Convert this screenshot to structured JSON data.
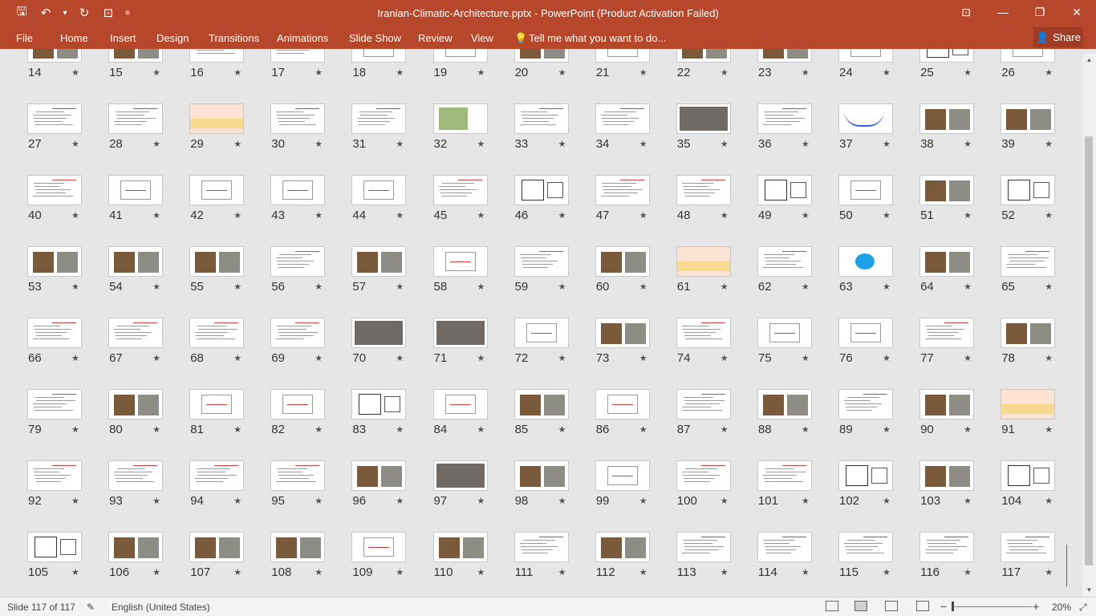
{
  "window": {
    "title": "Iranian-Climatic-Architecture.pptx - PowerPoint (Product Activation Failed)",
    "controls": {
      "ribbon_display": "⊡",
      "minimize": "—",
      "restore": "❐",
      "close": "✕"
    }
  },
  "qat": {
    "save": "🖫",
    "undo": "↶",
    "undo_dropdown": "▾",
    "redo": "↻",
    "present": "⊡",
    "customize": "≡"
  },
  "menu": {
    "items": [
      "File",
      "Home",
      "Insert",
      "Design",
      "Transitions",
      "Animations",
      "Slide Show",
      "Review",
      "View"
    ],
    "tell_me": "Tell me what you want to do...",
    "share": "Share"
  },
  "slides": {
    "star": "★",
    "numbers": [
      "14",
      "15",
      "16",
      "17",
      "18",
      "19",
      "20",
      "21",
      "22",
      "23",
      "24",
      "25",
      "26",
      "27",
      "28",
      "29",
      "30",
      "31",
      "32",
      "33",
      "34",
      "35",
      "36",
      "37",
      "38",
      "39",
      "40",
      "41",
      "42",
      "43",
      "44",
      "45",
      "46",
      "47",
      "48",
      "49",
      "50",
      "51",
      "52",
      "53",
      "54",
      "55",
      "56",
      "57",
      "58",
      "59",
      "60",
      "61",
      "62",
      "63",
      "64",
      "65",
      "66",
      "67",
      "68",
      "69",
      "70",
      "71",
      "72",
      "73",
      "74",
      "75",
      "76",
      "77",
      "78",
      "79",
      "80",
      "81",
      "82",
      "83",
      "84",
      "85",
      "86",
      "87",
      "88",
      "89",
      "90",
      "91",
      "92",
      "93",
      "94",
      "95",
      "96",
      "97",
      "98",
      "99",
      "100",
      "101",
      "102",
      "103",
      "104",
      "105",
      "106",
      "107",
      "108",
      "109",
      "110",
      "111",
      "112",
      "113",
      "114",
      "115",
      "116",
      "117"
    ],
    "kinds": [
      "photo",
      "photo",
      "text",
      "text",
      "diagram",
      "diagram",
      "photo",
      "diagram",
      "photo",
      "photo",
      "diagram",
      "plan",
      "diagram",
      "text",
      "text",
      "banner",
      "text",
      "text",
      "map",
      "text",
      "text",
      "gray",
      "text",
      "curve",
      "photo",
      "photo",
      "text",
      "diagram",
      "diagram",
      "diagram",
      "diagram",
      "text",
      "plan",
      "text",
      "text",
      "plan",
      "diagram",
      "photo",
      "plan",
      "photo",
      "photo",
      "photo",
      "text",
      "photo",
      "diagram",
      "text",
      "photo",
      "banner",
      "text",
      "blue",
      "photo",
      "text",
      "text",
      "text",
      "text",
      "text",
      "gray",
      "gray",
      "diagram",
      "photo",
      "text",
      "diagram",
      "diagram",
      "text",
      "photo",
      "text",
      "photo",
      "diagram",
      "diagram",
      "plan",
      "diagram",
      "photo",
      "diagram",
      "text",
      "photo",
      "text",
      "photo",
      "banner",
      "text",
      "text",
      "text",
      "text",
      "photo",
      "gray",
      "photo",
      "diagram",
      "text",
      "text",
      "plan",
      "photo",
      "plan",
      "plan",
      "photo",
      "photo",
      "photo",
      "diagram",
      "photo",
      "text",
      "photo",
      "text",
      "text",
      "text",
      "text",
      "text"
    ]
  },
  "status": {
    "slide_counter": "Slide 117 of 117",
    "language": "English (United States)",
    "zoom": "20%",
    "zoom_minus": "−",
    "zoom_plus": "+"
  }
}
